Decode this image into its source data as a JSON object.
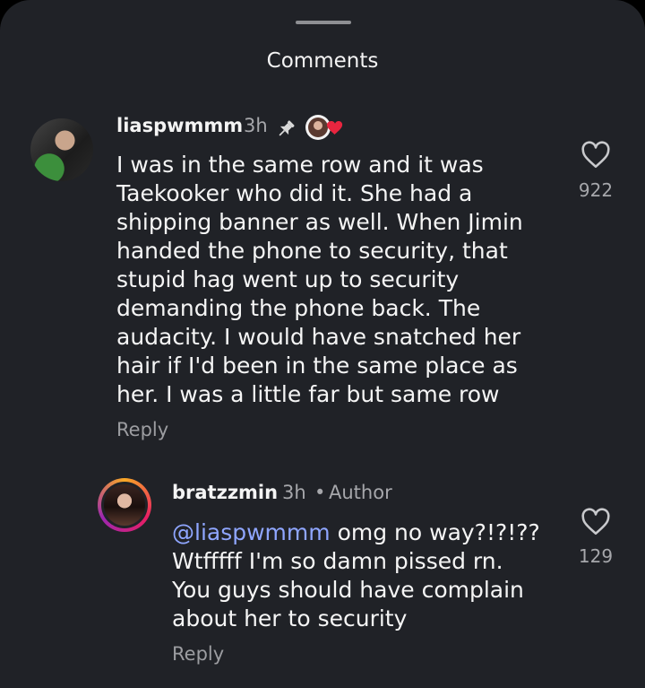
{
  "header": {
    "title": "Comments"
  },
  "comments": [
    {
      "username": "liaspwmmm",
      "time": "3h",
      "text": "I was in the same row and it was Taekooker who did it. She had a shipping banner as well. When Jimin handed the phone to security, that stupid hag went up to security demanding the phone back. The audacity. I would have snatched her hair if I'd been in the same place as her. I was a little far but same row",
      "reply_label": "Reply",
      "likes": "922"
    },
    {
      "username": "bratzzmin",
      "time": "3h",
      "separator": "•",
      "role": "Author",
      "mention": "@liaspwmmm",
      "text": " omg no way?!?!?? Wtfffff I'm so damn pissed rn. You guys should have complain about her to security",
      "reply_label": "Reply",
      "likes": "129"
    }
  ],
  "colors": {
    "background": "#202227",
    "mention": "#8fa6ff",
    "heart": "#e8253f"
  },
  "icons": [
    "pin-icon",
    "heart-outline-icon",
    "liked-by-author-sticker"
  ]
}
